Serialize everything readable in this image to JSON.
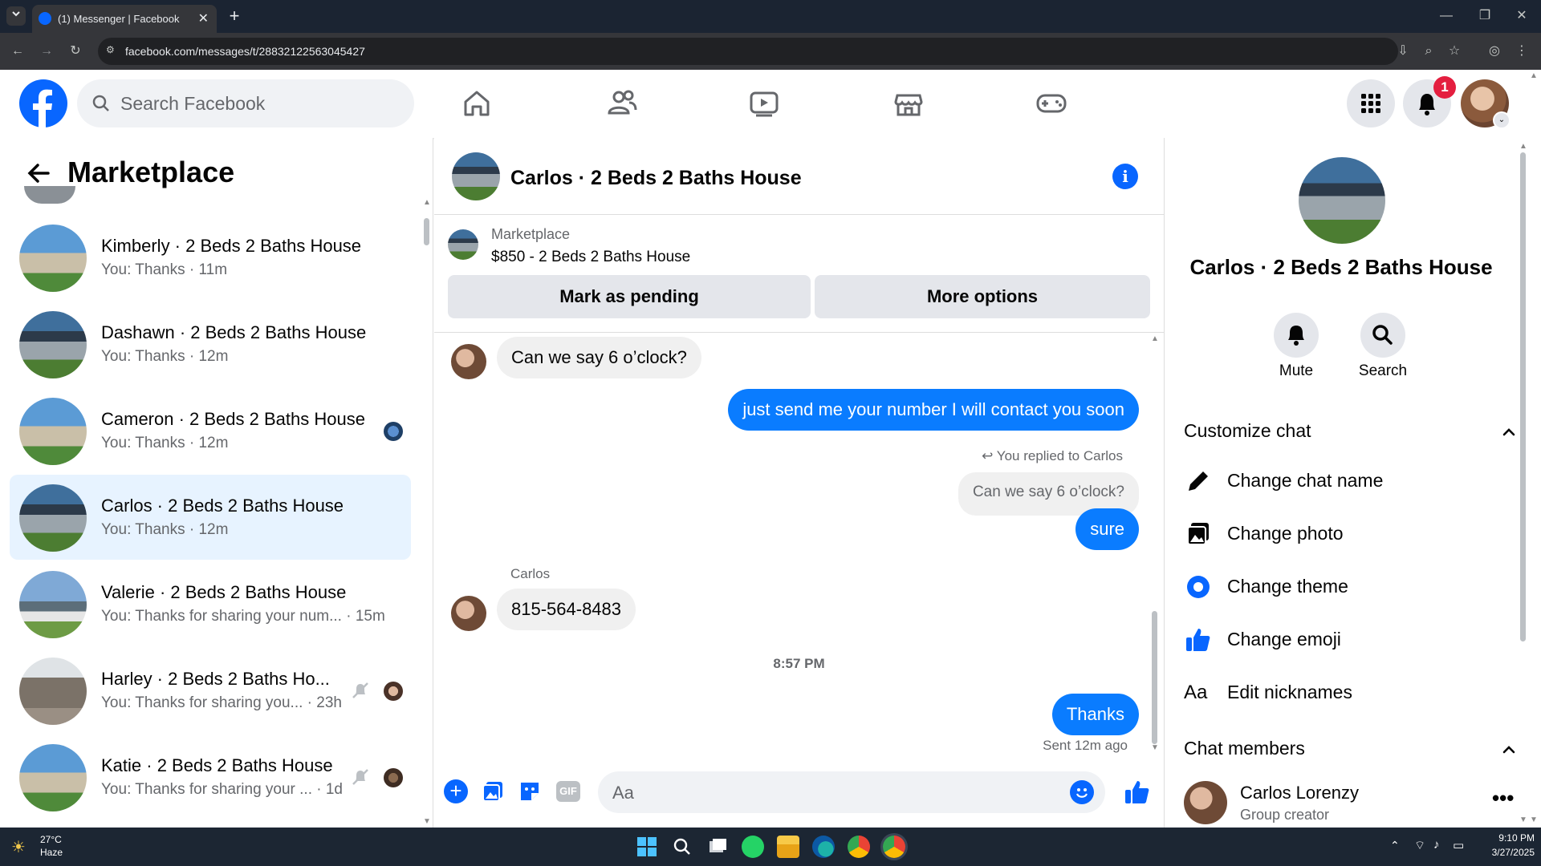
{
  "browser": {
    "tab_title": "(1) Messenger | Facebook",
    "url": "facebook.com/messages/t/28832122563045427"
  },
  "header": {
    "search_placeholder": "Search Facebook",
    "notification_count": "1"
  },
  "left": {
    "title": "Marketplace",
    "conversations": [
      {
        "title": "Kimberly · 2 Beds 2 Baths House",
        "sub": "You: Thanks · 11m"
      },
      {
        "title": "Dashawn · 2 Beds 2 Baths House",
        "sub": "You: Thanks · 12m"
      },
      {
        "title": "Cameron · 2 Beds 2 Baths House",
        "sub": "You: Thanks · 12m"
      },
      {
        "title": "Carlos · 2 Beds 2 Baths House",
        "sub": "You: Thanks · 12m"
      },
      {
        "title": "Valerie · 2 Beds 2 Baths House",
        "sub": "You: Thanks for sharing your num... · 15m"
      },
      {
        "title": "Harley · 2 Beds 2 Baths Ho...",
        "sub": "You: Thanks for sharing you... · 23h"
      },
      {
        "title": "Katie · 2 Beds 2 Baths House",
        "sub": "You: Thanks for sharing your ... · 1d"
      }
    ]
  },
  "chat": {
    "title": "Carlos · 2 Beds 2 Baths House",
    "listing_source": "Marketplace",
    "listing_title": "$850 - 2 Beds 2 Baths House",
    "mark_pending": "Mark as pending",
    "more_options": "More options",
    "messages": {
      "m1": "Can we say 6 o’clock?",
      "m2": "just send me your number I will contact you soon",
      "reply_note": "You replied to Carlos",
      "reply_quote": "Can we say 6 o’clock?",
      "m3": "sure",
      "sender_name": "Carlos",
      "m4": "815-564-8483",
      "timestamp": "8:57 PM",
      "m5": "Thanks",
      "sent_status": "Sent 12m ago"
    },
    "composer_placeholder": "Aa"
  },
  "details": {
    "title": "Carlos · 2 Beds 2 Baths House",
    "mute": "Mute",
    "search": "Search",
    "customize_header": "Customize chat",
    "change_name": "Change chat name",
    "change_photo": "Change photo",
    "change_theme": "Change theme",
    "change_emoji": "Change emoji",
    "edit_nicknames_icon": "Aa",
    "edit_nicknames": "Edit nicknames",
    "members_header": "Chat members",
    "member_name": "Carlos Lorenzy",
    "member_role": "Group creator"
  },
  "taskbar": {
    "weather_temp": "27°C",
    "weather_desc": "Haze",
    "time": "9:10 PM",
    "date": "3/27/2025"
  },
  "colors": {
    "fb_blue": "#0866ff",
    "bubble_blue": "#0a7cff",
    "badge_red": "#e41e3f"
  }
}
